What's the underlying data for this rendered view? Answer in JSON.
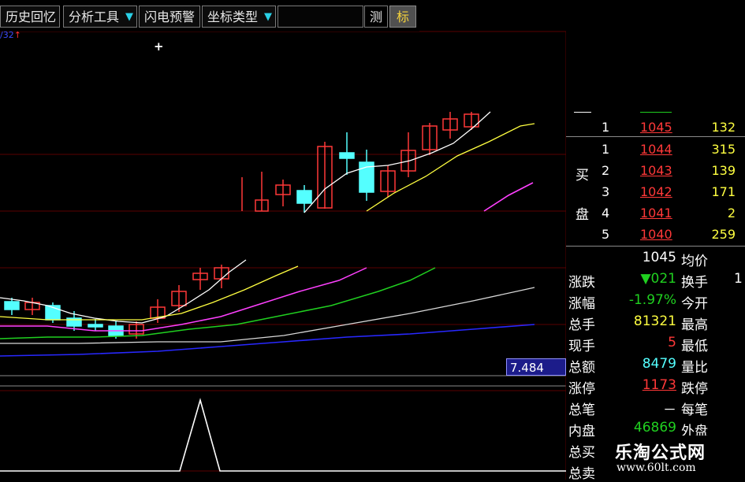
{
  "toolbar": {
    "history_label": "历史回忆",
    "analysis_label": "分析工具",
    "flash_label": "闪电预警",
    "coord_label": "坐标类型",
    "measure_label": "测",
    "mark_label": "标"
  },
  "top_readout": {
    "text": "/32",
    "arrow": "↑"
  },
  "crosshair": "+",
  "indicator_value": "7.484",
  "order_book": {
    "rows": [
      {
        "idx": "1",
        "price": "1045",
        "vol": "132"
      },
      {
        "idx": "1",
        "price": "1044",
        "vol": "315"
      },
      {
        "idx": "2",
        "price": "1043",
        "vol": "139"
      },
      {
        "idx": "3",
        "price": "1042",
        "vol": "171"
      },
      {
        "idx": "4",
        "price": "1041",
        "vol": "2"
      },
      {
        "idx": "5",
        "price": "1040",
        "vol": "259"
      }
    ],
    "buy_label_1": "买",
    "buy_label_2": "盘"
  },
  "stats": {
    "price": "1045",
    "avg_label": "均价",
    "change_label": "涨跌",
    "change_value": "▼021",
    "turnover_label": "换手",
    "turnover_value": "1",
    "pct_label": "涨幅",
    "pct_value": "-1.97%",
    "open_label": "今开",
    "vol_label": "总手",
    "vol_value": "81321",
    "high_label": "最高",
    "cur_label": "现手",
    "cur_value": "5",
    "low_label": "最低",
    "amount_label": "总额",
    "amount_value": "8479",
    "ratio_label": "量比",
    "limitup_label": "涨停",
    "limitup_value": "1173",
    "limitdown_label": "跌停",
    "bi_label": "总笔",
    "bi_value": "－",
    "perbi_label": "每笔",
    "inner_label": "内盘",
    "inner_value": "46869",
    "outer_label": "外盘",
    "buy_label": "总买",
    "sell_label": "总卖"
  },
  "watermark": {
    "title": "乐淘公式网",
    "url": "www.60lt.com"
  },
  "colors": {
    "up": "#ff3838",
    "down": "#54ffff",
    "ma_white": "#ffffff",
    "ma_yellow": "#ffff40",
    "ma_magenta": "#ff40ff",
    "ma_green": "#20d020",
    "ma_blue": "#2828ff"
  }
}
